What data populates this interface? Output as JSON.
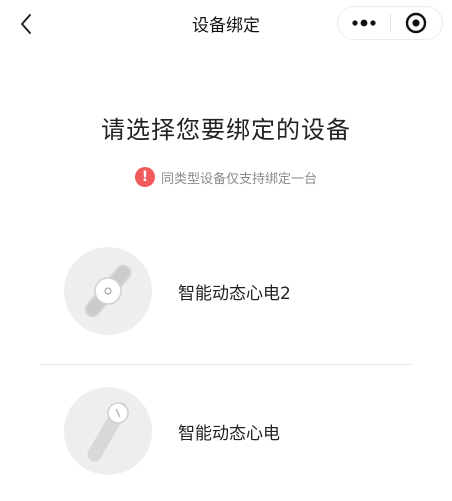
{
  "nav": {
    "title": "设备绑定",
    "back_icon": "chevron-left-icon",
    "more_icon": "more-dots-icon",
    "close_icon": "target-circle-icon"
  },
  "main": {
    "heading": "请选择您要绑定的设备",
    "notice": {
      "icon": "exclamation-icon",
      "icon_glyph": "!",
      "text": "同类型设备仅支持绑定一台",
      "color": "#f15a5a"
    },
    "devices": [
      {
        "name": "智能动态心电2",
        "image": "ecg-band-device-1"
      },
      {
        "name": "智能动态心电",
        "image": "ecg-patch-device-2"
      }
    ]
  }
}
